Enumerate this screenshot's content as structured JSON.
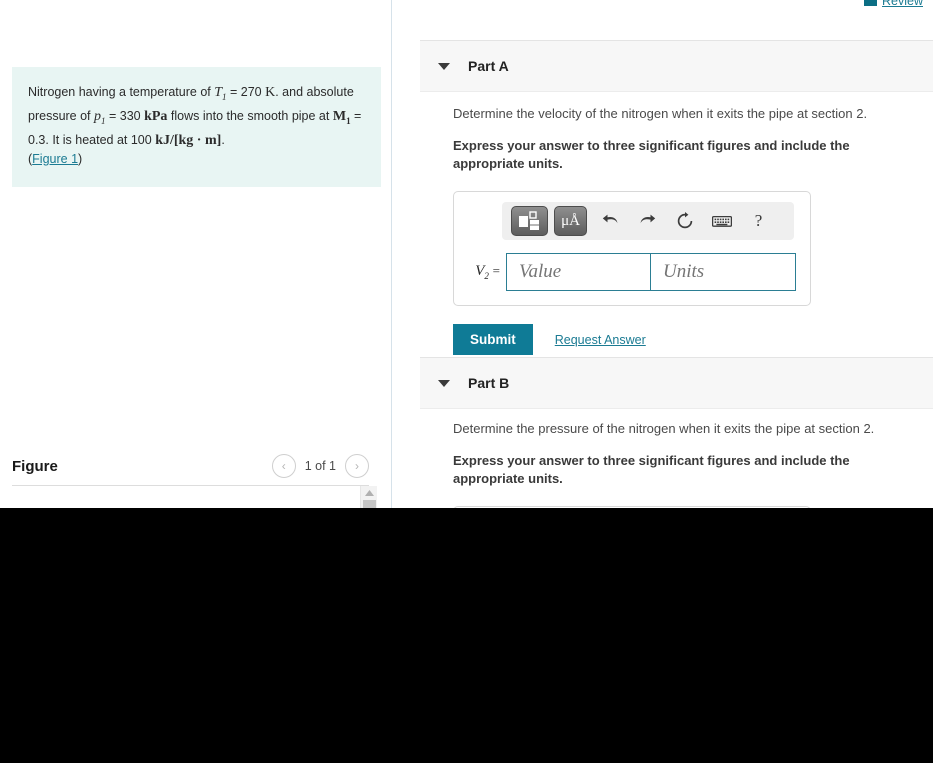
{
  "review": {
    "label": "Review",
    "icon": "review-icon"
  },
  "problem": {
    "line1_pre": "Nitrogen having a temperature of ",
    "T_sym": "T",
    "T_sub": "1",
    "T_eq": " = 270 ",
    "T_unit": "K",
    "line1_post": ". and",
    "line2_pre": "absolute pressure of ",
    "p_sym": "p",
    "p_sub": "1",
    "p_eq": " = 330 ",
    "p_unit": "kPa",
    "line2_post": " flows into the smooth",
    "line3_pre": "pipe at ",
    "M_sym": "M",
    "M_sub": "1",
    "M_eq": " = 0.3. It is heated at 100 ",
    "heat_unit": "kJ/[kg · m]",
    "line3_post": ".",
    "figure_link": "(Figure 1)",
    "figure_link_open": "(",
    "figure_link_text": "Figure 1",
    "figure_link_close": ")"
  },
  "figure": {
    "title": "Figure",
    "counter": "1 of 1",
    "prev_glyph": "‹",
    "next_glyph": "›"
  },
  "toolbar": {
    "template_button": "template-layout-button",
    "units_button": "μÅ",
    "undo": "↶",
    "redo": "↷",
    "reset": "↻",
    "keyboard": "keyboard-icon",
    "help": "?"
  },
  "parts": [
    {
      "label": "Part A",
      "question": "Determine the velocity of the nitrogen when it exits the pipe at section 2.",
      "instruction": "Express your answer to three significant figures and include the appropriate units.",
      "variable_symbol": "V",
      "variable_subscript": "2",
      "variable_equals": "=",
      "value_placeholder": "Value",
      "units_placeholder": "Units",
      "value": "",
      "units": "",
      "submit_label": "Submit",
      "request_answer_label": "Request Answer"
    },
    {
      "label": "Part B",
      "question": "Determine the pressure of the nitrogen when it exits the pipe at section 2.",
      "instruction": "Express your answer to three significant figures and include the appropriate units."
    }
  ],
  "colors": {
    "accent_teal": "#0f7b96",
    "link_teal": "#1b7b93",
    "problem_box_bg": "#e8f5f3",
    "part_header_bg": "#f7f7f7",
    "input_border": "#2b7e93"
  }
}
